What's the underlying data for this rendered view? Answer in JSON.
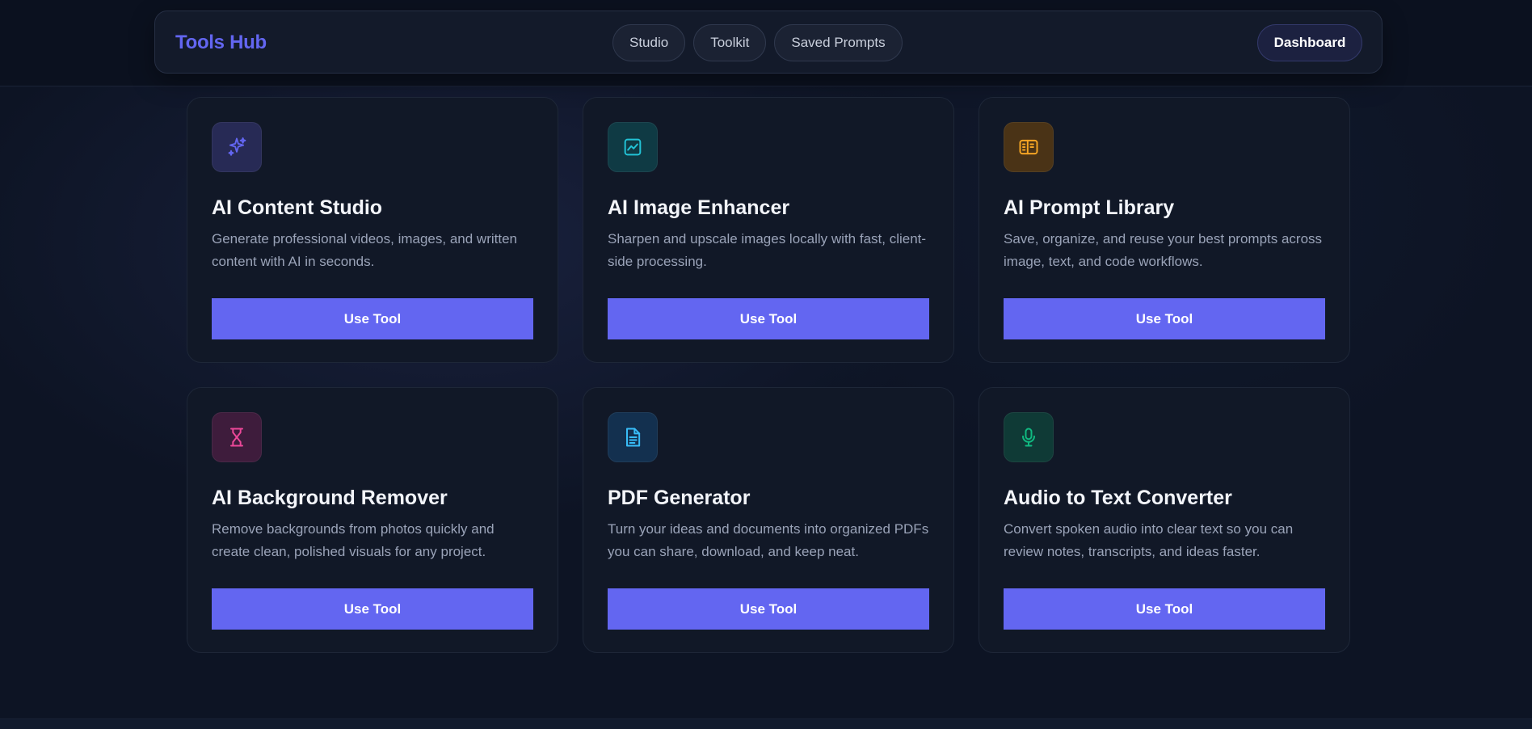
{
  "brand": "Tools Hub",
  "nav": [
    "Studio",
    "Toolkit",
    "Saved Prompts"
  ],
  "dashboard_label": "Dashboard",
  "cards": [
    {
      "title": "AI Content Studio",
      "desc": "Generate professional videos, images, and written content with AI in seconds.",
      "button": "Use Tool",
      "icon": "sparkles-icon",
      "color": "#6366f1",
      "tint": "#272a55"
    },
    {
      "title": "AI Image Enhancer",
      "desc": "Sharpen and upscale images locally with fast, client-side processing.",
      "button": "Use Tool",
      "icon": "image-chart-icon",
      "color": "#22c3d6",
      "tint": "#0f3a44"
    },
    {
      "title": "AI Prompt Library",
      "desc": "Save, organize, and reuse your best prompts across image, text, and code workflows.",
      "button": "Use Tool",
      "icon": "library-icon",
      "color": "#f5a524",
      "tint": "#4a3316"
    },
    {
      "title": "AI Background Remover",
      "desc": "Remove backgrounds from photos quickly and create clean, polished visuals for any project.",
      "button": "Use Tool",
      "icon": "hourglass-icon",
      "color": "#ec4899",
      "tint": "#3e1c3c"
    },
    {
      "title": "PDF Generator",
      "desc": "Turn your ideas and documents into organized PDFs you can share, download, and keep neat.",
      "button": "Use Tool",
      "icon": "document-icon",
      "color": "#38bdf8",
      "tint": "#13304f"
    },
    {
      "title": "Audio to Text Converter",
      "desc": "Convert spoken audio into clear text so you can review notes, transcripts, and ideas faster.",
      "button": "Use Tool",
      "icon": "microphone-icon",
      "color": "#10b981",
      "tint": "#0f3a36"
    }
  ]
}
